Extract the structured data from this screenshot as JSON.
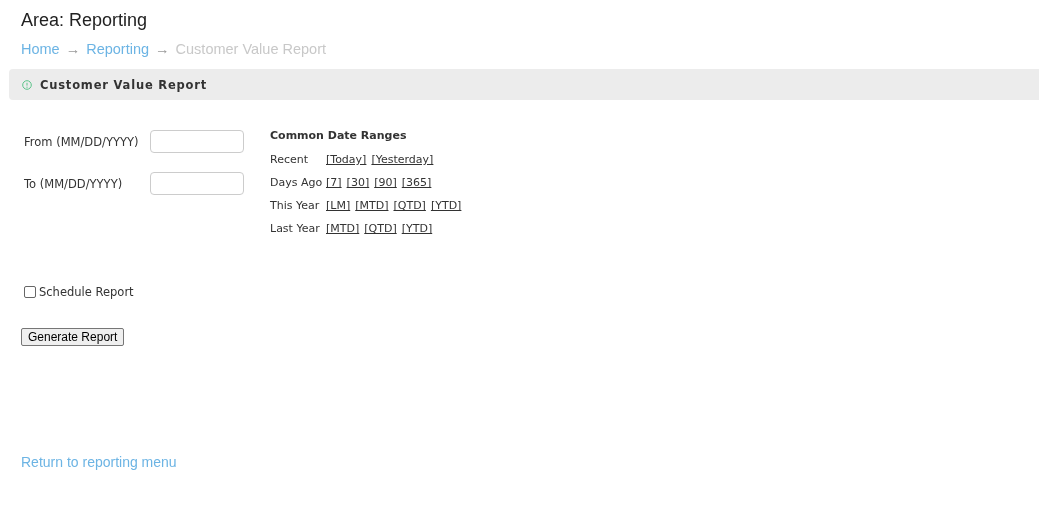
{
  "area_title": "Area: Reporting",
  "breadcrumb": [
    {
      "label": "Home",
      "kind": "link"
    },
    {
      "label": "→",
      "kind": "separator"
    },
    {
      "label": "Reporting",
      "kind": "link"
    },
    {
      "label": "→",
      "kind": "separator"
    },
    {
      "label": "Customer Value Report",
      "kind": "current"
    }
  ],
  "panel": {
    "title": "Customer Value Report"
  },
  "fields": [
    {
      "label": "From (MM/DD/YYYY)"
    },
    {
      "label": "To (MM/DD/YYYY)"
    }
  ],
  "date_ranges": {
    "title": "Common Date Ranges",
    "rows": [
      {
        "label": "Recent",
        "links": [
          "[Today]",
          "[Yesterday]"
        ]
      },
      {
        "label": "Days Ago",
        "links": [
          "[7]",
          "[30]",
          "[90]",
          "[365]"
        ]
      },
      {
        "label": "This Year",
        "links": [
          "[LM]",
          "[MTD]",
          "[QTD]",
          "[YTD]"
        ]
      },
      {
        "label": "Last Year",
        "links": [
          "[MTD]",
          "[QTD]",
          "[YTD]"
        ]
      }
    ]
  },
  "schedule": {
    "label": "Schedule Report",
    "checked": false
  },
  "generate_button": "Generate Report",
  "return_link": "Return to reporting menu"
}
